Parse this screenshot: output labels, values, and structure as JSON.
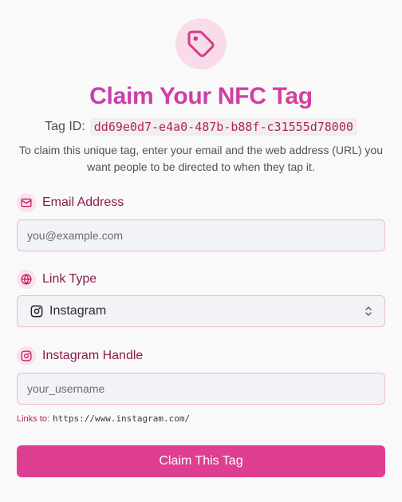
{
  "header": {
    "icon": "tag-icon",
    "title": "Claim Your NFC Tag",
    "tag_label": "Tag ID:",
    "tag_id": "dd69e0d7-e4a0-487b-b88f-c31555d78000",
    "description": "To claim this unique tag, enter your email and the web address (URL) you want people to be directed to when they tap it."
  },
  "form": {
    "email": {
      "icon": "mail-icon",
      "label": "Email Address",
      "placeholder": "you@example.com",
      "value": ""
    },
    "link_type": {
      "icon": "globe-icon",
      "label": "Link Type",
      "selected_icon": "instagram-icon",
      "selected": "Instagram"
    },
    "handle": {
      "icon": "instagram-icon",
      "label": "Instagram Handle",
      "placeholder": "your_username",
      "value": ""
    },
    "links_to_label": "Links to:",
    "links_to_url": "https://www.instagram.com/",
    "submit_label": "Claim This Tag"
  },
  "colors": {
    "accent": "#de3f91",
    "label_text": "#8a1c4c",
    "title_gradient_start": "#c43fb8",
    "title_gradient_end": "#d9408f",
    "input_border": "#f2b6cf",
    "background": "#f9f9fa"
  }
}
